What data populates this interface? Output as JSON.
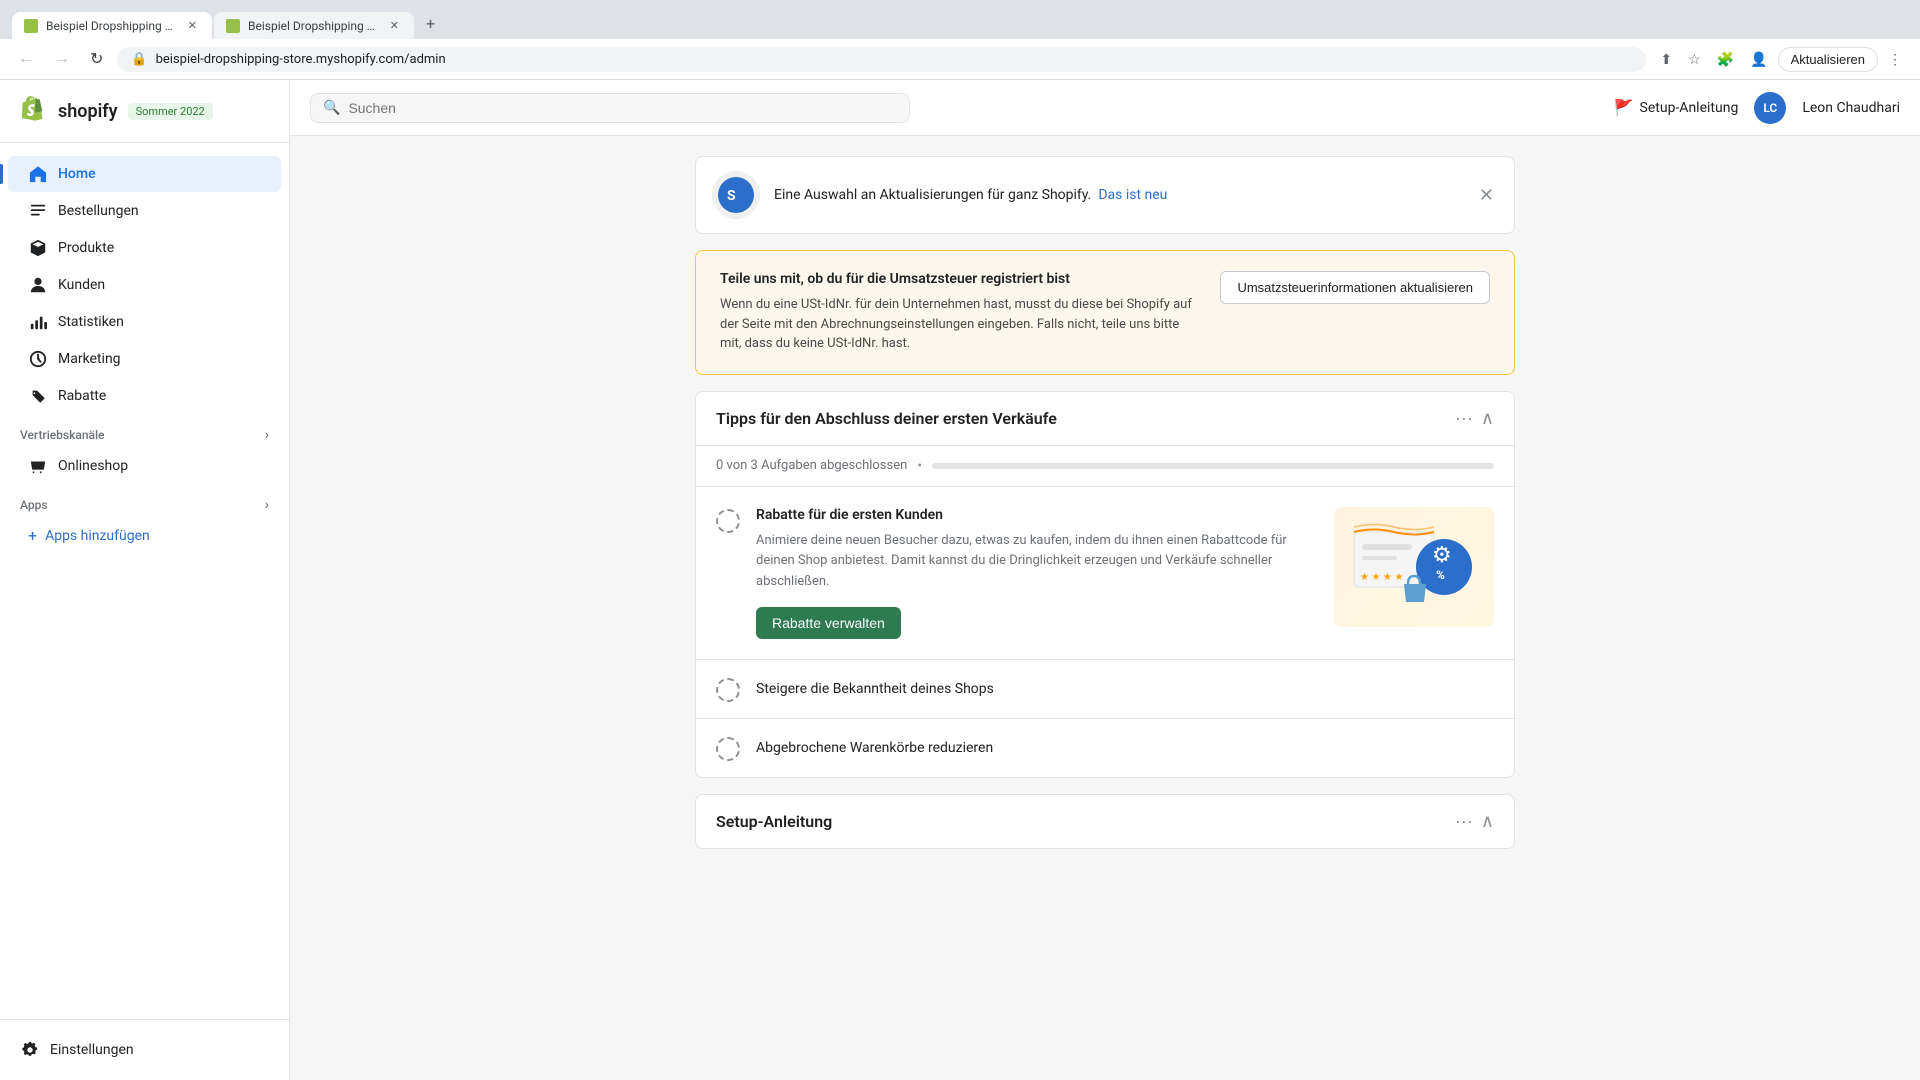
{
  "browser": {
    "tabs": [
      {
        "label": "Beispiel Dropshipping Store ·",
        "active": true
      },
      {
        "label": "Beispiel Dropshipping Store",
        "active": false
      }
    ],
    "address": "beispiel-dropshipping-store.myshopify.com/admin",
    "update_btn": "Aktualisieren"
  },
  "sidebar": {
    "logo": "shopify",
    "badge": "Sommer 2022",
    "nav_items": [
      {
        "id": "home",
        "label": "Home",
        "icon": "home",
        "active": true
      },
      {
        "id": "orders",
        "label": "Bestellungen",
        "icon": "orders",
        "active": false
      },
      {
        "id": "products",
        "label": "Produkte",
        "icon": "products",
        "active": false
      },
      {
        "id": "customers",
        "label": "Kunden",
        "icon": "customers",
        "active": false
      },
      {
        "id": "analytics",
        "label": "Statistiken",
        "icon": "analytics",
        "active": false
      },
      {
        "id": "marketing",
        "label": "Marketing",
        "icon": "marketing",
        "active": false
      },
      {
        "id": "discounts",
        "label": "Rabatte",
        "icon": "discounts",
        "active": false
      }
    ],
    "sales_channels_label": "Vertriebskanäle",
    "sales_channels": [
      {
        "id": "online-store",
        "label": "Onlineshop",
        "icon": "store"
      }
    ],
    "apps_label": "Apps",
    "apps_items": [
      {
        "id": "add-apps",
        "label": "Apps hinzufügen"
      }
    ],
    "settings_label": "Einstellungen"
  },
  "topbar": {
    "search_placeholder": "Suchen",
    "setup_guide_label": "Setup-Anleitung",
    "user_initials": "LC",
    "user_name": "Leon Chaudhari"
  },
  "notification_banner": {
    "text": "Eine Auswahl an Aktualisierungen für ganz Shopify.",
    "link_text": "Das ist neu"
  },
  "tax_card": {
    "title": "Teile uns mit, ob du für die Umsatzsteuer registriert bist",
    "description": "Wenn du eine USt-IdNr. für dein Unternehmen hast, musst du diese bei Shopify auf der Seite mit den Abrechnungseinstellungen eingeben. Falls nicht, teile uns bitte mit, dass du keine USt-IdNr. hast.",
    "button_label": "Umsatzsteuerinformationen aktualisieren"
  },
  "tips_card": {
    "title": "Tipps für den Abschluss deiner ersten Verkäufe",
    "progress_text": "0 von 3 Aufgaben abgeschlossen",
    "progress_value": 0,
    "items": [
      {
        "id": "discounts",
        "title": "Rabatte für die ersten Kunden",
        "description": "Animiere deine neuen Besucher dazu, etwas zu kaufen, indem du ihnen einen Rabattcode für deinen Shop anbietest. Damit kannst du die Dringlichkeit erzeugen und Verkäufe schneller abschließen.",
        "button_label": "Rabatte verwalten",
        "expanded": true
      },
      {
        "id": "shop-popularity",
        "title": "Steigere die Bekanntheit deines Shops",
        "expanded": false
      },
      {
        "id": "abandoned-carts",
        "title": "Abgebrochene Warenkörbe reduzieren",
        "expanded": false
      }
    ]
  },
  "setup_card": {
    "title": "Setup-Anleitung"
  }
}
